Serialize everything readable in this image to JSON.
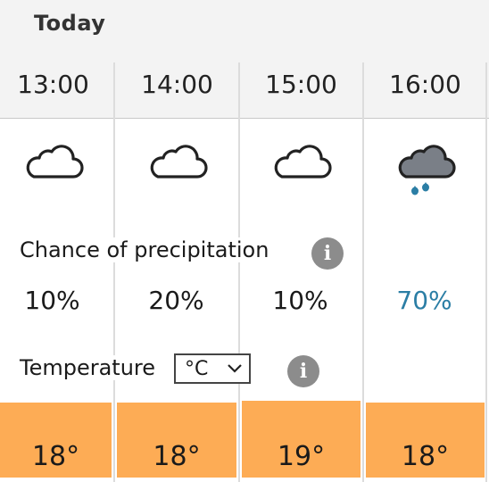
{
  "header": {
    "day_label": "Today"
  },
  "hours": [
    {
      "time": "13:00",
      "icon": "cloud-icon",
      "precip": "10%",
      "precip_high": false,
      "temp": "18°",
      "temp_color": "#fdac55"
    },
    {
      "time": "14:00",
      "icon": "cloud-icon",
      "precip": "20%",
      "precip_high": false,
      "temp": "18°",
      "temp_color": "#fdac55"
    },
    {
      "time": "15:00",
      "icon": "cloud-icon",
      "precip": "10%",
      "precip_high": false,
      "temp": "19°",
      "temp_color": "#fdac55"
    },
    {
      "time": "16:00",
      "icon": "rain-cloud-icon",
      "precip": "70%",
      "precip_high": true,
      "temp": "18°",
      "temp_color": "#fdac55"
    }
  ],
  "precipitation": {
    "label": "Chance of precipitation",
    "info_icon": "info-icon",
    "info_glyph": "i"
  },
  "temperature": {
    "label": "Temperature",
    "unit_selected": "°C",
    "info_icon": "info-icon",
    "info_glyph": "i"
  },
  "colors": {
    "precip_high": "#2b7ea5",
    "temp_warm": "#fdac55",
    "header_bg": "#f3f3f3",
    "info_bg": "#8c8c8c"
  }
}
